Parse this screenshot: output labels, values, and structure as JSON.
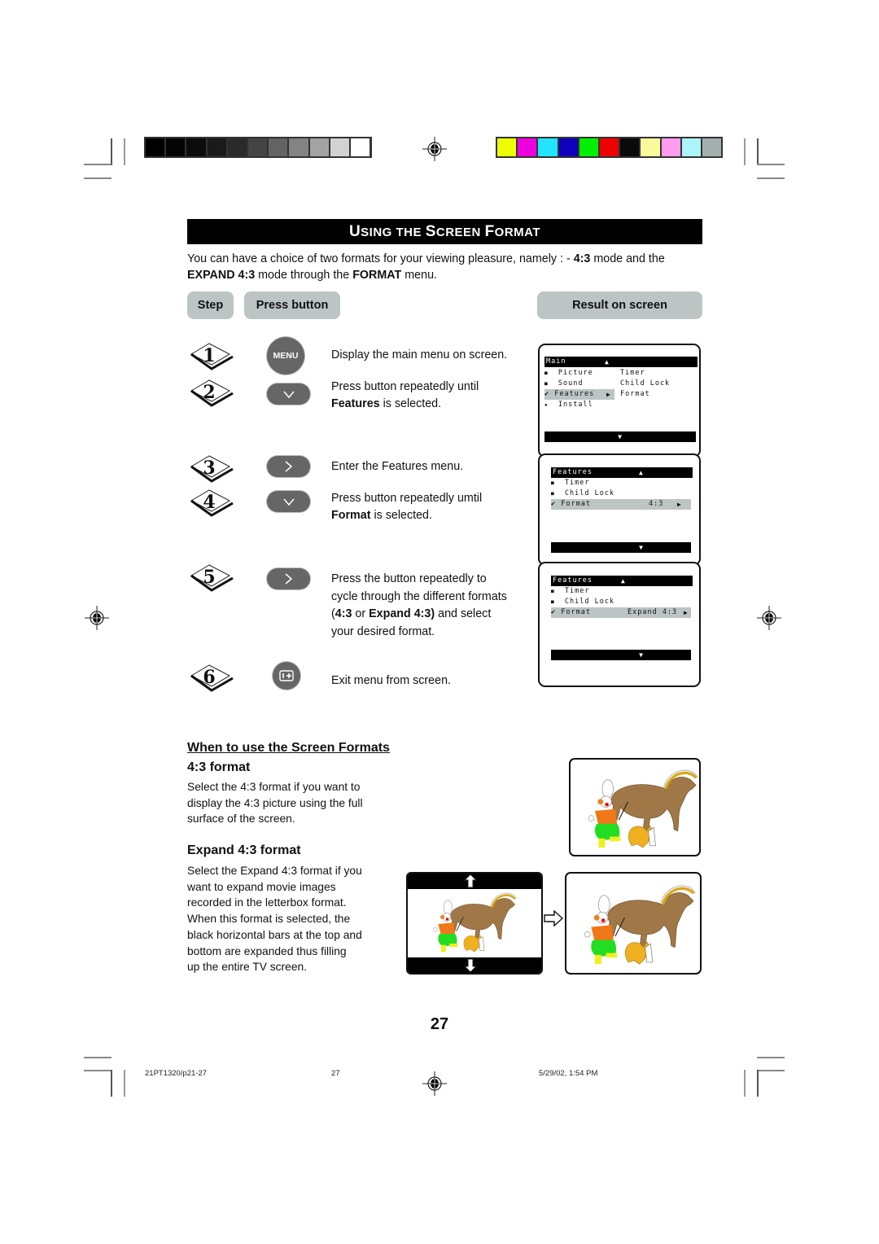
{
  "color_bars": {
    "grayscale": [
      "#000000",
      "#040404",
      "#0c0c0c",
      "#1a1a1a",
      "#2a2a2a",
      "#444444",
      "#636363",
      "#838383",
      "#a3a3a3",
      "#d2d2d2",
      "#ffffff"
    ],
    "colors": [
      "#eeff00",
      "#ee00dd",
      "#22e4ff",
      "#1100bb",
      "#00f000",
      "#ee0000",
      "#0a0a0a",
      "#fafa9a",
      "#ff9cee",
      "#aaf4fa",
      "#a4b0ae"
    ]
  },
  "header": {
    "title_parts": [
      {
        "text": "U",
        "size": "big"
      },
      {
        "text": "SING THE ",
        "size": "sm"
      },
      {
        "text": "S",
        "size": "big"
      },
      {
        "text": "CREEN ",
        "size": "sm"
      },
      {
        "text": "F",
        "size": "big"
      },
      {
        "text": "ORMAT",
        "size": "sm"
      }
    ],
    "title": "Using the Screen Format"
  },
  "intro": {
    "t1": "You can have a choice of two formats for your viewing pleasure, namely : - ",
    "b1": "4:3",
    "t2": " mode and the ",
    "b2": "EXPAND 4:3",
    "t3": " mode through the ",
    "b3": "FORMAT",
    "t4": " menu."
  },
  "columns": {
    "step": "Step",
    "press_button": "Press button",
    "result": "Result on screen"
  },
  "steps": [
    {
      "num": "1",
      "button": "MENU",
      "button_icon": "menu-button",
      "desc_plain": "Display the main menu on screen."
    },
    {
      "num": "2",
      "button": "v",
      "button_icon": "cursor-down-button",
      "desc_plain": "Press button repeatedly until",
      "desc_bold": "Features",
      "desc_tail": " is selected."
    },
    {
      "num": "3",
      "button": ">",
      "button_icon": "cursor-right-button",
      "desc_plain": "Enter the Features menu."
    },
    {
      "num": "4",
      "button": "v",
      "button_icon": "cursor-down-button",
      "desc_plain": "Press button repeatedly umtil",
      "desc_bold": "Format",
      "desc_tail": " is selected."
    },
    {
      "num": "5",
      "button": ">",
      "button_icon": "cursor-right-button",
      "desc_l1": "Press the button repeatedly to",
      "desc_l2": "cycle through the different formats",
      "desc_l3a": "(",
      "desc_l3b": "4:3",
      "desc_l3c": " or  ",
      "desc_l3d": "Expand 4:3)",
      "desc_l3e": " and select",
      "desc_l4": "your desired format."
    },
    {
      "num": "6",
      "button": "i+",
      "button_icon": "osd-exit-button",
      "desc_plain": "Exit menu from screen."
    }
  ],
  "osd_screens": [
    {
      "header": "Main",
      "items": [
        {
          "mark": "■",
          "label": "Picture",
          "right": "Timer"
        },
        {
          "mark": "■",
          "label": "Sound",
          "right": "Child Lock"
        },
        {
          "mark": "✔",
          "label": "Features",
          "right": "Format",
          "selected": true
        },
        {
          "mark": "▪",
          "label": "Install",
          "right": ""
        }
      ]
    },
    {
      "header": "Features",
      "items": [
        {
          "mark": "■",
          "label": "Timer",
          "value": ""
        },
        {
          "mark": "■",
          "label": "Child Lock",
          "value": ""
        },
        {
          "mark": "✔",
          "label": "Format",
          "value": "4:3",
          "selected": true
        }
      ]
    },
    {
      "header": "Features",
      "items": [
        {
          "mark": "■",
          "label": "Timer",
          "value": ""
        },
        {
          "mark": "■",
          "label": "Child Lock",
          "value": ""
        },
        {
          "mark": "✔",
          "label": "Format",
          "value": "Expand 4:3",
          "selected": true
        }
      ]
    }
  ],
  "when_section": {
    "heading": "When to use the Screen Formats",
    "format43_title": "4:3 format",
    "format43_lines": [
      "Select the 4:3 format if you want to",
      "display the 4:3 picture using the full",
      "surface of the screen."
    ],
    "expand_title": "Expand 4:3 format",
    "expand_lines": [
      "Select the Expand 4:3 format if you",
      "want to expand movie images",
      "recorded in the letterbox format.",
      "When this format is selected, the",
      "black horizontal bars at the top and",
      "bottom are expanded thus filling",
      "up the entire TV screen."
    ]
  },
  "page_number": "27",
  "footer": {
    "file": "21PT1320/p21-27",
    "page": "27",
    "timestamp": "5/29/02, 1:54 PM"
  }
}
